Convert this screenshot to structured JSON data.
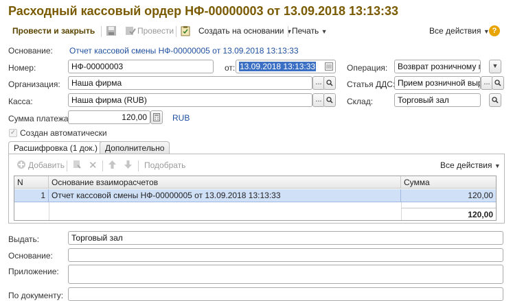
{
  "title": "Расходный кассовый ордер НФ-00000003 от 13.09.2018 13:13:33",
  "toolbar": {
    "post_close": "Провести и закрыть",
    "post": "Провести",
    "create_based": "Создать на основании",
    "print": "Печать",
    "all_actions": "Все действия",
    "help": "?"
  },
  "form": {
    "basis_label": "Основание:",
    "basis_link": "Отчет кассовой смены НФ-00000005 от 13.09.2018 13:13:33",
    "number_label": "Номер:",
    "number_value": "НФ-00000003",
    "from_label": "от:",
    "date_value": "13.09.2018 13:13:33",
    "operation_label": "Операция:",
    "operation_value": "Возврат розничному покуп",
    "org_label": "Организация:",
    "org_value": "Наша фирма",
    "dds_label": "Статья ДДС:",
    "dds_value": "Прием розничной выруч",
    "cash_label": "Касса:",
    "cash_value": "Наша фирма (RUB)",
    "warehouse_label": "Склад:",
    "warehouse_value": "Торговый зал",
    "sum_label": "Сумма платежа:",
    "sum_value": "120,00",
    "currency": "RUB",
    "auto_label": "Создан автоматически"
  },
  "tabs": {
    "decoding": "Расшифровка (1 док.)",
    "additional": "Дополнительно"
  },
  "table_toolbar": {
    "add": "Добавить",
    "pick": "Подобрать",
    "all_actions": "Все действия"
  },
  "table": {
    "headers": {
      "n": "N",
      "basis": "Основание взаиморасчетов",
      "sum": "Сумма"
    },
    "rows": [
      {
        "n": "1",
        "basis": "Отчет кассовой смены НФ-00000005 от 13.09.2018 13:13:33",
        "sum": "120,00"
      }
    ],
    "total": "120,00"
  },
  "bottom": {
    "issue_label": "Выдать:",
    "issue_value": "Торговый зал",
    "basis_label": "Основание:",
    "basis_value": "",
    "attachment_label": "Приложение:",
    "attachment_value": "",
    "doc_label": "По документу:",
    "doc_value": ""
  },
  "colors": {
    "title": "#7a5a00",
    "link": "#1f4fa0",
    "selection": "#cfe0f7"
  }
}
